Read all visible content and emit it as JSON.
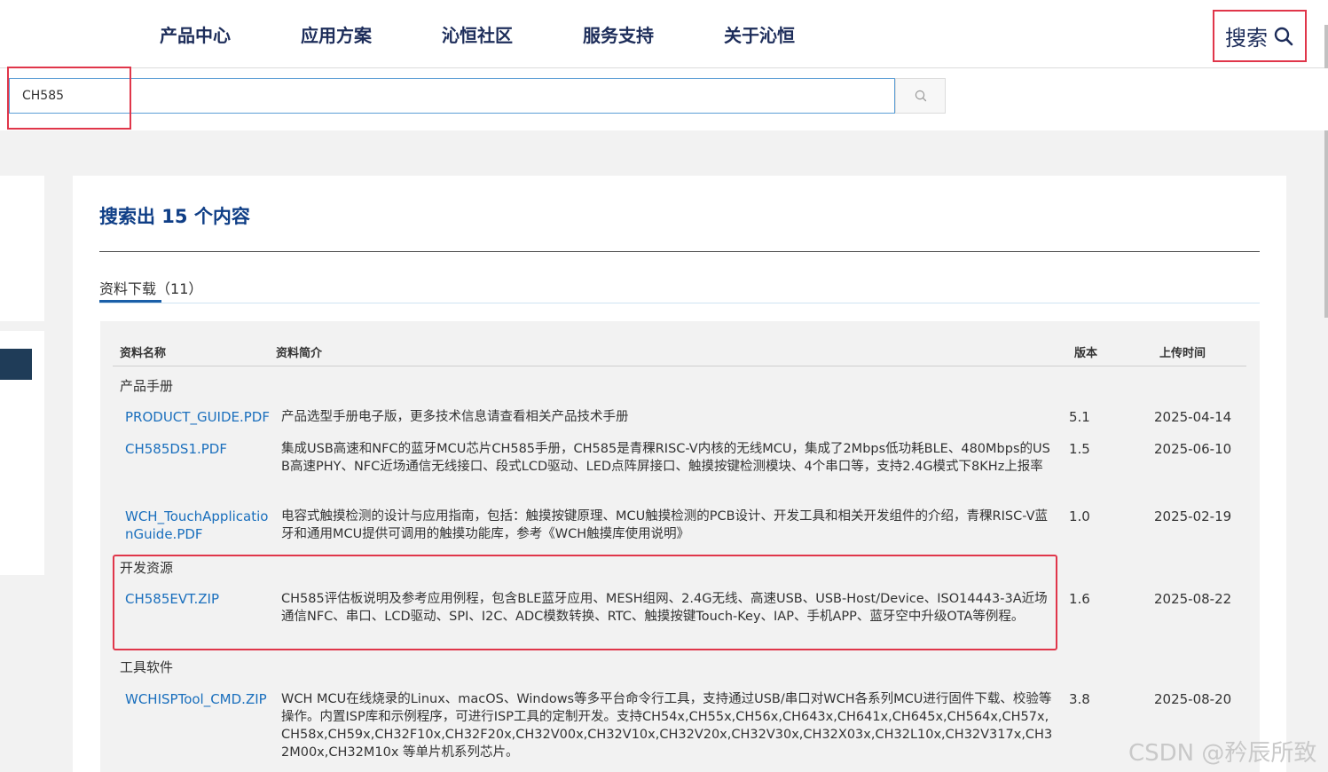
{
  "nav": {
    "items": [
      "产品中心",
      "应用方案",
      "沁恒社区",
      "服务支持",
      "关于沁恒"
    ],
    "search_label": "搜索"
  },
  "search": {
    "value": "CH585"
  },
  "results": {
    "title": "搜索出 15 个内容",
    "tab_label": "资料下载",
    "tab_count": "（11）"
  },
  "table": {
    "headers": {
      "name": "资料名称",
      "desc": "资料简介",
      "version": "版本",
      "date": "上传时间"
    },
    "categories": [
      {
        "label": "产品手册"
      },
      {
        "label": "开发资源"
      },
      {
        "label": "工具软件"
      }
    ],
    "rows": [
      {
        "file": "PRODUCT_GUIDE.PDF",
        "desc": "产品选型手册电子版，更多技术信息请查看相关产品技术手册",
        "version": "5.1",
        "date": "2025-04-14"
      },
      {
        "file": "CH585DS1.PDF",
        "desc": "集成USB高速和NFC的蓝牙MCU芯片CH585手册，CH585是青稞RISC-V内核的无线MCU，集成了2Mbps低功耗BLE、480Mbps的USB高速PHY、NFC近场通信无线接口、段式LCD驱动、LED点阵屏接口、触摸按键检测模块、4个串口等，支持2.4G模式下8KHz上报率",
        "version": "1.5",
        "date": "2025-06-10"
      },
      {
        "file": "WCH_TouchApplicationGuide.PDF",
        "desc": "电容式触摸检测的设计与应用指南，包括：触摸按键原理、MCU触摸检测的PCB设计、开发工具和相关开发组件的介绍，青稞RISC-V蓝牙和通用MCU提供可调用的触摸功能库，参考《WCH触摸库使用说明》",
        "version": "1.0",
        "date": "2025-02-19"
      },
      {
        "file": "CH585EVT.ZIP",
        "desc": "CH585评估板说明及参考应用例程，包含BLE蓝牙应用、MESH组网、2.4G无线、高速USB、USB-Host/Device、ISO14443-3A近场通信NFC、串口、LCD驱动、SPI、I2C、ADC模数转换、RTC、触摸按键Touch-Key、IAP、手机APP、蓝牙空中升级OTA等例程。",
        "version": "1.6",
        "date": "2025-08-22"
      },
      {
        "file": "WCHISPTool_CMD.ZIP",
        "desc": "WCH MCU在线烧录的Linux、macOS、Windows等多平台命令行工具，支持通过USB/串口对WCH各系列MCU进行固件下载、校验等操作。内置ISP库和示例程序，可进行ISP工具的定制开发。支持CH54x,CH55x,CH56x,CH643x,CH641x,CH645x,CH564x,CH57x,CH58x,CH59x,CH32F10x,CH32F20x,CH32V00x,CH32V10x,CH32V20x,CH32V30x,CH32X03x,CH32L10x,CH32V317x,CH32M00x,CH32M10x 等单片机系列芯片。",
        "version": "3.8",
        "date": "2025-08-20"
      }
    ]
  },
  "watermark": "CSDN @矜辰所致",
  "colors": {
    "accent": "#1a6fbd",
    "title": "#0f3e86",
    "highlight": "#e0364a",
    "nav": "#1d2d5a"
  }
}
